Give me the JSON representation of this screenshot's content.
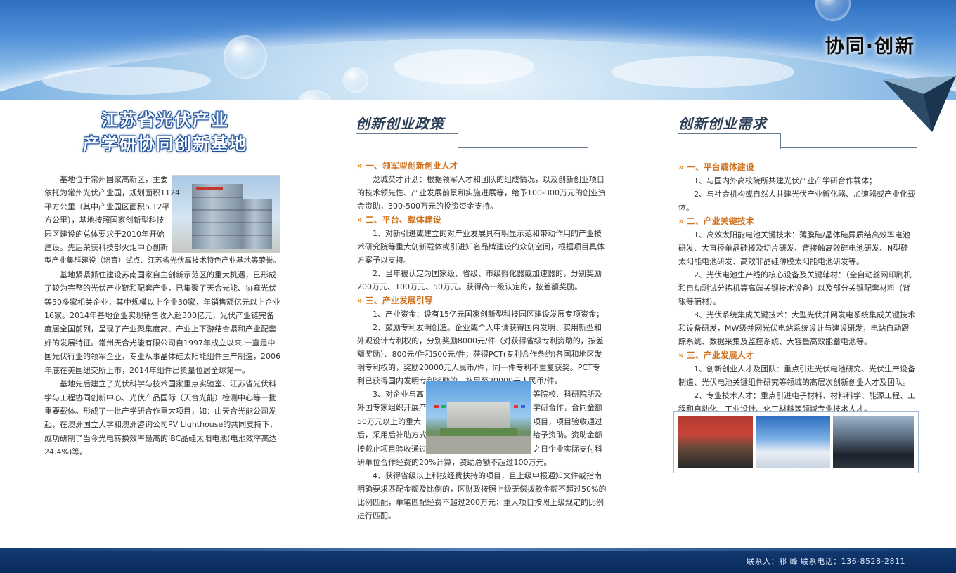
{
  "banner": {
    "brand": "协同·创新"
  },
  "left": {
    "title_line1": "江苏省光伏产业",
    "title_line2": "产学研协同创新基地",
    "wrap_lines": [
      "基地位于常州国家高新区，主要",
      "依托为常州光伏产业园，规划面积1124",
      "平方公里（其中产业园区面积5.12平",
      "方公里），基地按照国家创新型科技",
      "园区建设的总体要求于2010年开始",
      "建设。先后荣获科技部火炬中心创新",
      "型产业集群建设（培育）试点、江苏省光伏高技术特色产业基地等荣誉。"
    ],
    "paragraphs": [
      "基地紧紧抓住建设苏南国家自主创新示范区的重大机遇，已形成了较为完整的光伏产业链和配套产业，已集聚了天合光能、协鑫光伏等50多家相关企业，其中规模以上企业30家，年销售额亿元以上企业16家。2014年基地企业实现销售收入超300亿元，光伏产业链完备度居全国前列，呈现了产业聚集度高、产业上下游结合紧和产业配套好的发展特征。常州天合光能有限公司自1997年成立以来,一直是中国光伏行业的领军企业，专业从事晶体硅太阳能组件生产制造，2006年底在美国纽交所上市，2014年组件出货量位居全球第一。",
      "基地先后建立了光伏科学与技术国家重点实验室、江苏省光伏科学与工程协同创新中心、光伏产品国际（天合光能）检测中心等一批重要载体。形成了一批产学研合作重大项目，如：由天合光能公司发起，在澳洲国立大学和澳洲咨询公司PV Lighthouse的共同支持下，成功研制了当今光电转换效率最高的IBC晶硅太阳电池(电池效率高达24.4%)等。"
    ]
  },
  "middle": {
    "heading": "创新创业政策",
    "s1_title": "一、领军型创新创业人才",
    "s1_p1": "龙城英才计划：根据领军人才和团队的组成情况，以及创新创业项目的技术领先性、产业发展前景和实施进展等，给予100-300万元的创业资金资助，300-500万元的投资资金支持。",
    "s2_title": "二、平台、载体建设",
    "s2_p1": "1、对新引进或建立的对产业发展具有明显示范和带动作用的产业技术研究院等重大创新载体或引进知名品牌建设的众创空间，根据项目具体方案予以支持。",
    "s2_p2": "2、当年被认定为国家级、省级、市级孵化器或加速器的，分别奖励200万元、100万元、50万元。获得高一级认定的，按差额奖励。",
    "s3_title": "三、产业发展引导",
    "s3_p1": "1、产业资金：设有15亿元国家创新型科技园区建设发展专项资金；",
    "s3_p2": "2、鼓励专利发明创造。企业或个人申请获得国内发明、实用新型和外观设计专利权的，分别奖励8000元/件（对获得省级专利资助的，按差额奖励）、800元/件和500元/件；获得PCT(专利合作条约)各国和地区发明专利权的，奖励20000元人民币/件，同一件专利不重复获奖。PCT专利已获得国内发明专利奖励的，补足至20000元人民币/件。",
    "s3_p3_left": [
      "3、对企业与高",
      "外国专家组织开展产",
      "50万元以上的重大",
      "后，采用后补助方式",
      "按截止项目验收通过"
    ],
    "s3_p3_right": [
      "等院校、科研院所及",
      "学研合作，合同金额",
      "项目，项目验收通过",
      "给予资助。资助金额",
      "之日企业实际支付科"
    ],
    "s3_p3_tail": "研单位合作经费的20%计算，资助总额不超过100万元。",
    "s3_p4": "4、获得省级以上科技经费扶持的项目，且上级申报通知文件或指南明确要求匹配金额及比例的，区财政按照上级无偿拨款金额不超过50%的比例匹配，单笔匹配经费不超过200万元；重大项目按照上级规定的比例进行匹配。"
  },
  "right": {
    "heading": "创新创业需求",
    "s1_title": "一、平台载体建设",
    "s1_p1": "1、与国内外高校院所共建光伏产业产学研合作载体；",
    "s1_p2": "2、与社会机构或自然人共建光伏产业孵化器、加速器或产业化载体。",
    "s2_title": "二、产业关键技术",
    "s2_p1": "1、高效太阳能电池关键技术：薄膜硅/晶体硅异质结高效率电池研发、大直径单晶硅棒及切片研发、背接触高效硅电池研发、N型硅太阳能电池研发、高效非晶硅薄膜太阳能电池研发等。",
    "s2_p2": "2、光伏电池生产线的核心设备及关键辅材：（全自动丝网印刷机和自动测试分拣机等高端关键技术设备）以及部分关键配套材料（背银等辅材）。",
    "s2_p3": "3、光伏系统集成关键技术：大型光伏并网发电系统集成关键技术和设备研发，MW级并网光伏电站系统设计与建设研发，电站自动跟踪系统、数据采集及监控系统、大容量高效能蓄电池等。",
    "s3_title": "三、产业发展人才",
    "s3_p1": "1、创新创业人才及团队：重点引进光伏电池研究、光伏生产设备制造、光伏电池关键组件研究等领域的高层次创新创业人才及团队。",
    "s3_p2": "2、专业技术人才：重点引进电子材料、材料科学、能源工程、工程和自动化、工业设计、化工材料等领域专业技术人才。"
  },
  "footer": {
    "contact": "联系人：祁  峰  联系电话：136-8528-2811"
  },
  "colors": {
    "accent": "#d0701a",
    "footer": "#0a2b5c",
    "title_outline": "#1d4f98"
  }
}
